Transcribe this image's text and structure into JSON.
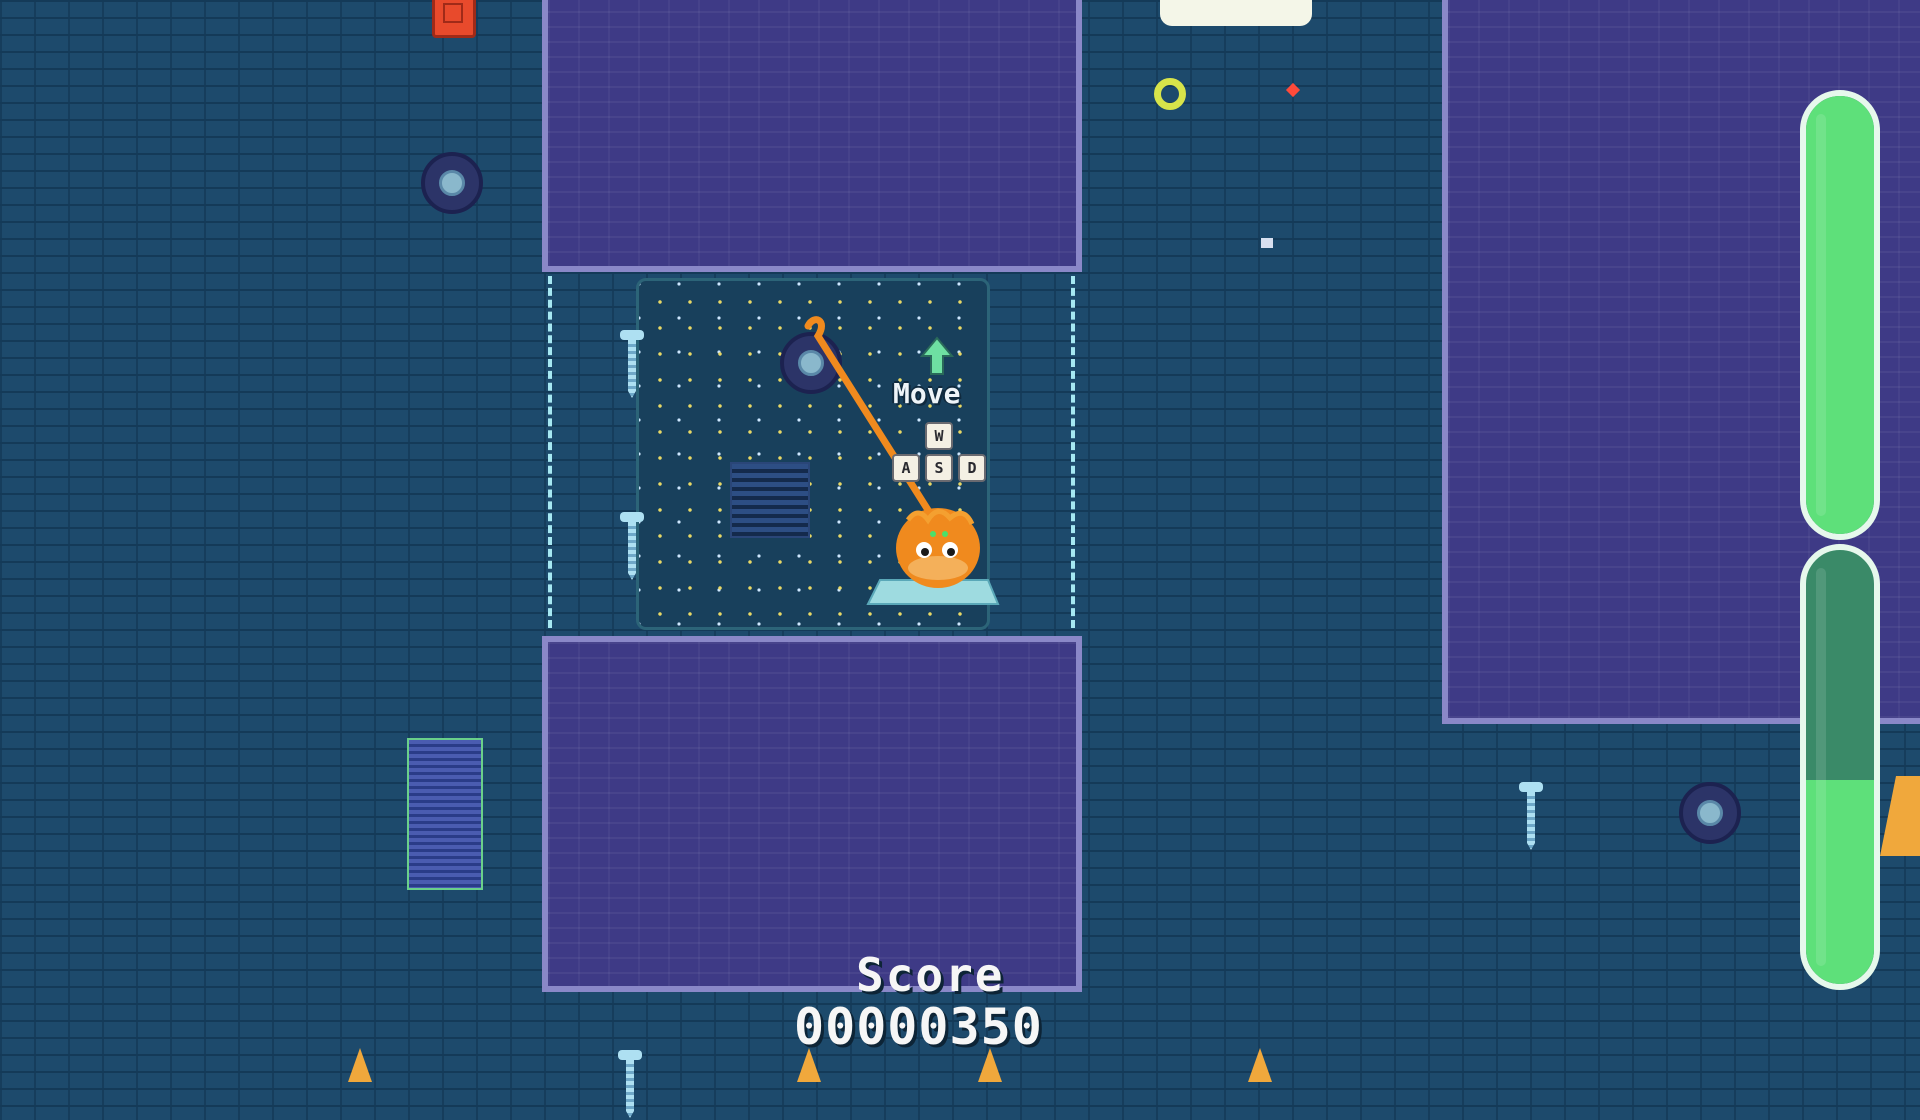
{
  "hud": {
    "move_hint": "Move",
    "keys": {
      "w": "W",
      "a": "A",
      "s": "S",
      "d": "D"
    },
    "score_label": "Score",
    "score_value": "00000350"
  },
  "energy": {
    "upper_level": 1.0,
    "lower_level": 0.47
  },
  "colors": {
    "floor": "#1d4a6c",
    "wall": "#3e3a86",
    "wall_border": "#8a88c8",
    "player": "#f08a1e",
    "energy": "#5ee07a"
  }
}
